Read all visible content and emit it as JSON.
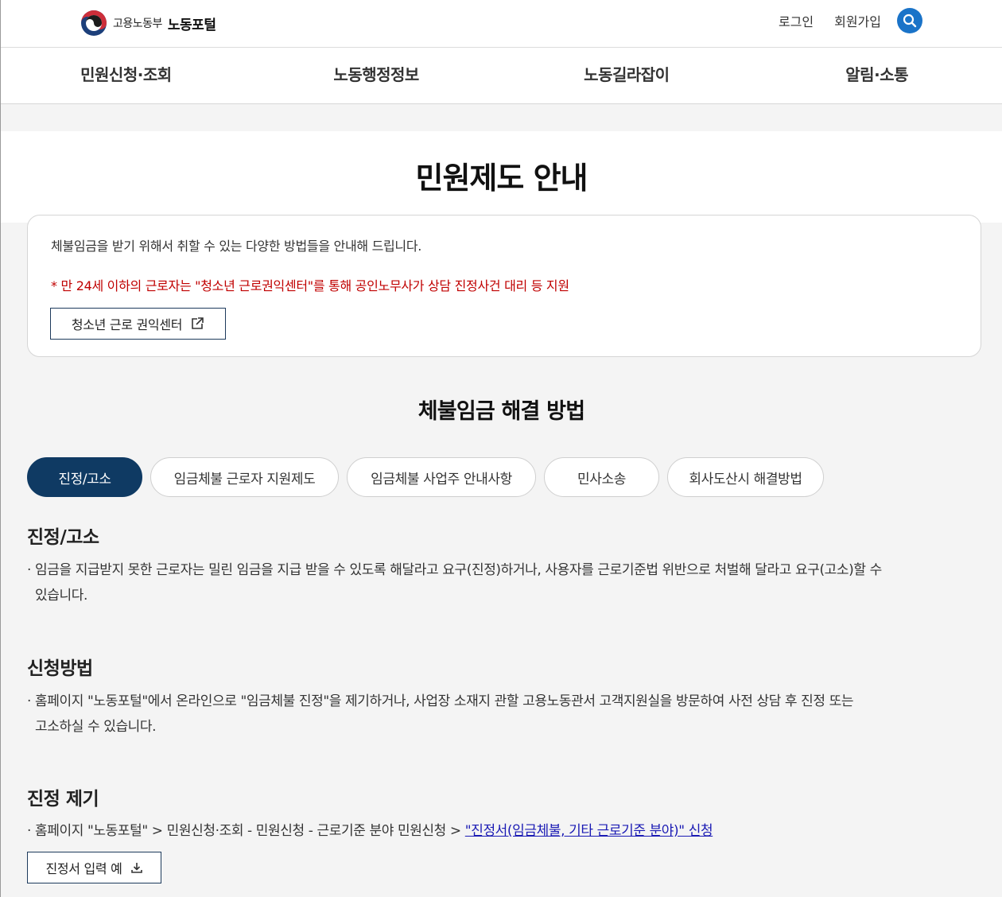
{
  "header": {
    "ministry": "고용노동부",
    "portal": "노동포털",
    "login": "로그인",
    "signup": "회원가입"
  },
  "gnb": [
    "민원신청·조회",
    "노동행정정보",
    "노동길라잡이",
    "알림·소통"
  ],
  "page_title": "민원제도 안내",
  "info": {
    "text": "체불임금을 받기 위해서 취할 수 있는 다양한 방법들을 안내해 드립니다.",
    "warning": "* 만 24세 이하의 근로자는 \"청소년 근로권익센터\"를 통해 공인노무사가 상담 진정사건 대리 등 지원",
    "button": "청소년 근로 권익센터"
  },
  "section_title": "체불임금 해결 방법",
  "tabs": [
    "진정/고소",
    "임금체불 근로자 지원제도",
    "임금체불 사업주 안내사항",
    "민사소송",
    "회사도산시 해결방법"
  ],
  "content": {
    "s1_title": "진정/고소",
    "s1_line1": "임금을 지급받지 못한 근로자는 밀린 임금을 지급 받을 수 있도록 해달라고 요구(진정)하거나, 사용자를 근로기준법 위반으로 처벌해 달라고 요구(고소)할 수",
    "s1_line2": "있습니다.",
    "s2_title": "신청방법",
    "s2_line1": "홈페이지 \"노동포털\"에서 온라인으로 \"임금체불 진정\"을 제기하거나, 사업장 소재지 관할 고용노동관서 고객지원실을 방문하여 사전 상담 후 진정 또는",
    "s2_line2": "고소하실 수 있습니다.",
    "s3_title": "진정 제기",
    "s3_path": "홈페이지 \"노동포털\" > 민원신청·조회 - 민원신청 - 근로기준 분야 민원신청 >",
    "s3_link": "\"진정서(임금체불, 기타 근로기준 분야)\" 신청",
    "s3_button": "진정서 입력 예"
  },
  "bullet": "·",
  "colors": {
    "primary": "#0f3a63",
    "warning": "#c00000",
    "search": "#1a73c8",
    "link": "#1a1ab4"
  },
  "icons": [
    "taegeuk-logo-icon",
    "search-icon",
    "external-link-icon",
    "download-icon"
  ]
}
